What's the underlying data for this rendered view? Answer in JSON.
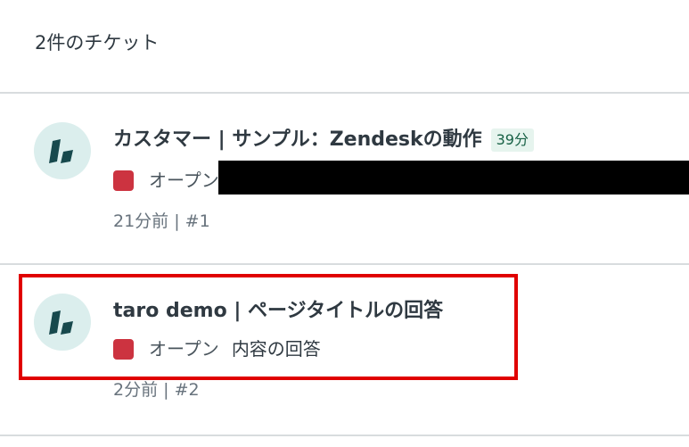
{
  "header": {
    "ticket_count": "2件のチケット"
  },
  "tickets": [
    {
      "title": "カスタマー | サンプル：Zendeskの動作",
      "time_badge": "39分",
      "status": "オープン",
      "status_color": "#cc3340",
      "description": "",
      "meta": "21分前 | #1",
      "avatar_icon": "zendesk-logo-icon"
    },
    {
      "title": "taro demo | ページタイトルの回答",
      "status": "オープン",
      "status_color": "#cc3340",
      "description": "内容の回答",
      "meta": "2分前 | #2",
      "avatar_icon": "zendesk-logo-icon"
    }
  ],
  "colors": {
    "highlight": "#e00000",
    "avatar_bg": "#dbeeed",
    "badge_bg": "#e6f4ee",
    "badge_text": "#186146"
  }
}
